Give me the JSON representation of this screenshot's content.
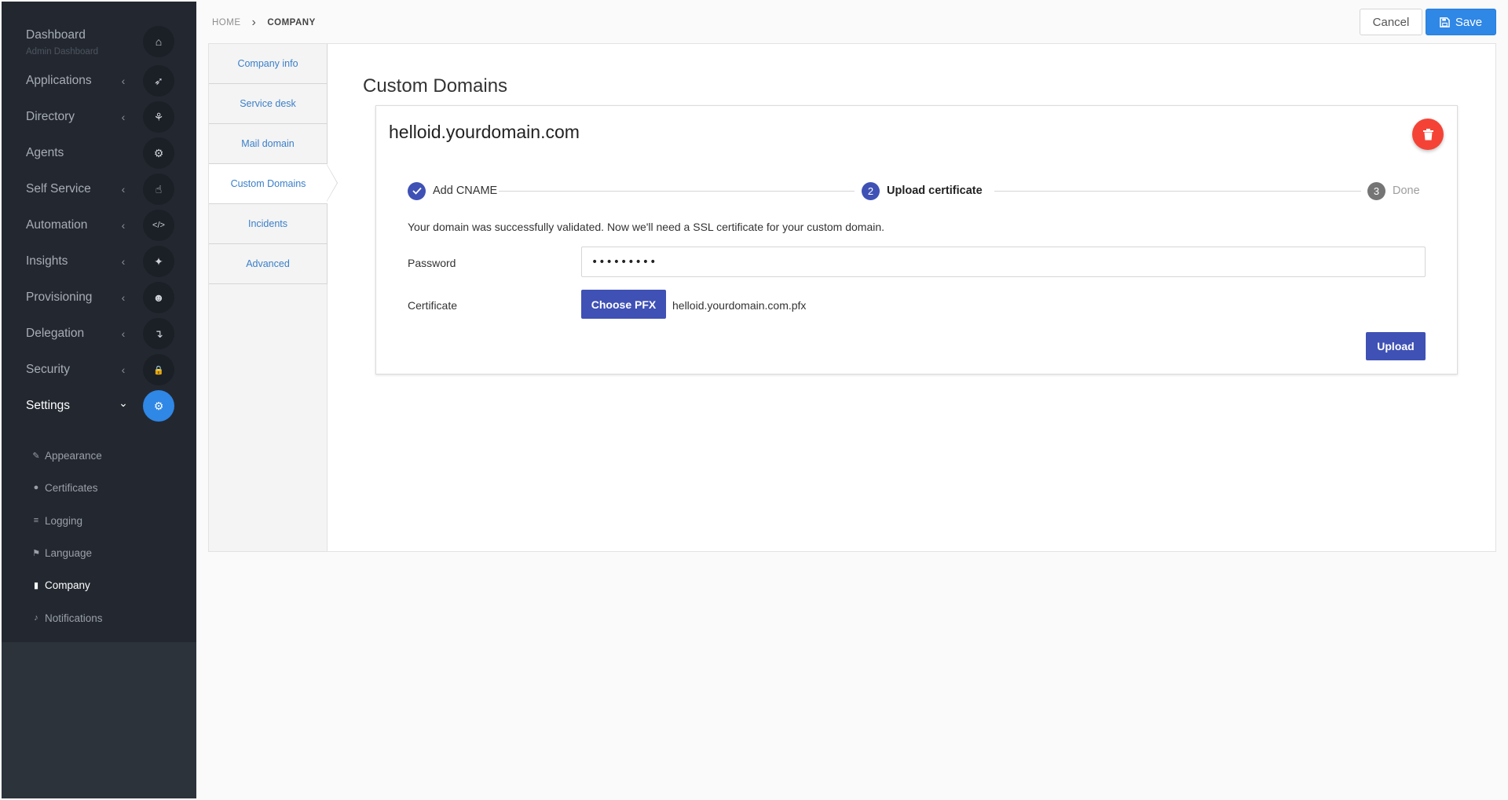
{
  "breadcrumb": {
    "home": "HOME",
    "separator": "›",
    "current": "COMPANY"
  },
  "toolbar": {
    "cancel_label": "Cancel",
    "save_label": "Save",
    "save_icon": "floppy-disk-icon"
  },
  "sidebar": {
    "dashboard_sub": "Admin Dashboard",
    "items": [
      {
        "label": "Dashboard",
        "icon": "home-icon",
        "glyph": "⌂",
        "chevron": ""
      },
      {
        "label": "Applications",
        "icon": "rocket-icon",
        "glyph": "➶",
        "chevron": "‹"
      },
      {
        "label": "Directory",
        "icon": "sitemap-icon",
        "glyph": "⚘",
        "chevron": "‹"
      },
      {
        "label": "Agents",
        "icon": "cogs-icon",
        "glyph": "⚙",
        "chevron": ""
      },
      {
        "label": "Self Service",
        "icon": "hand-pointer-icon",
        "glyph": "☝",
        "chevron": "‹"
      },
      {
        "label": "Automation",
        "icon": "code-icon",
        "glyph": "</>",
        "chevron": "‹"
      },
      {
        "label": "Insights",
        "icon": "lightbulb-icon",
        "glyph": "✦",
        "chevron": "‹"
      },
      {
        "label": "Provisioning",
        "icon": "users-icon",
        "glyph": "☻",
        "chevron": "‹"
      },
      {
        "label": "Delegation",
        "icon": "level-down-icon",
        "glyph": "↴",
        "chevron": "‹"
      },
      {
        "label": "Security",
        "icon": "lock-icon",
        "glyph": "🔒",
        "chevron": "‹"
      },
      {
        "label": "Settings",
        "icon": "gear-icon",
        "glyph": "⚙",
        "chevron": "⌄"
      }
    ],
    "settings_sub": [
      {
        "label": "Appearance",
        "icon": "paint-brush-icon",
        "glyph": "✎"
      },
      {
        "label": "Certificates",
        "icon": "certificate-icon",
        "glyph": "●"
      },
      {
        "label": "Logging",
        "icon": "database-icon",
        "glyph": "≡"
      },
      {
        "label": "Language",
        "icon": "language-icon",
        "glyph": "⚑"
      },
      {
        "label": "Company",
        "icon": "building-icon",
        "glyph": "▮"
      },
      {
        "label": "Notifications",
        "icon": "bell-icon",
        "glyph": "♪"
      }
    ],
    "active_item": "Settings",
    "active_sub": "Company"
  },
  "tabs": [
    "Company info",
    "Service desk",
    "Mail domain",
    "Custom Domains",
    "Incidents",
    "Advanced"
  ],
  "active_tab": "Custom Domains",
  "section_title": "Custom Domains",
  "domain_card": {
    "domain": "helloid.yourdomain.com",
    "steps": [
      {
        "number": "1",
        "label": "Add CNAME",
        "state": "completed"
      },
      {
        "number": "2",
        "label": "Upload certificate",
        "state": "current"
      },
      {
        "number": "3",
        "label": "Done",
        "state": "pending"
      }
    ],
    "message": "Your domain was successfully validated. Now we'll need a SSL certificate for your custom domain.",
    "password_label": "Password",
    "password_value": "•••••••••",
    "certificate_label": "Certificate",
    "choose_pfx_label": "Choose PFX",
    "file_name": "helloid.yourdomain.com.pfx",
    "upload_label": "Upload"
  },
  "colors": {
    "primary": "#3f51b5",
    "accent": "#2f87e6",
    "danger": "#f44336",
    "sidebar": "#232830"
  }
}
